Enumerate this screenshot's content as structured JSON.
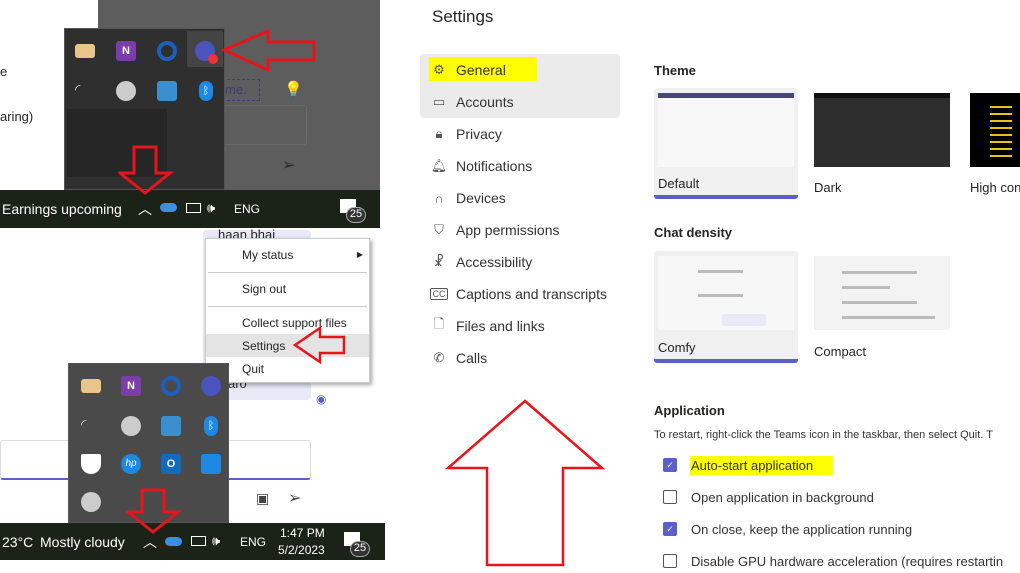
{
  "top_panel": {
    "bg_text_1": "e",
    "bg_text_2": "aring)",
    "input_text": "me.",
    "taskbar": {
      "news": "Earnings upcoming",
      "lang": "ENG",
      "notifications": "25"
    },
    "tray_icons": [
      "mail-icon",
      "onenote-icon",
      "cortana-icon",
      "teams-icon",
      "wifi-icon",
      "moon-icon",
      "network-app-icon",
      "bluetooth-icon"
    ]
  },
  "bottom_panel": {
    "bg_text": "haan bhai",
    "bg_text_2": "aro",
    "context_menu": {
      "items": [
        {
          "label": "My status",
          "submenu": true
        },
        {
          "label": "Sign out"
        },
        {
          "label": "Collect support files"
        },
        {
          "label": "Settings",
          "hovered": true
        },
        {
          "label": "Quit"
        }
      ]
    },
    "tray_icons": [
      "mail-icon",
      "onenote-icon",
      "cortana-icon",
      "teams-icon",
      "wifi-icon",
      "moon-icon",
      "network-app-icon",
      "bluetooth-icon",
      "security-warning-icon",
      "hp-icon",
      "outlook-icon",
      "cloud-sync-icon",
      "vpn-icon"
    ],
    "taskbar": {
      "weather": "23°C",
      "condition": "Mostly cloudy",
      "lang": "ENG",
      "time": "1:47 PM",
      "date": "5/2/2023",
      "notifications": "25"
    }
  },
  "settings": {
    "title": "Settings",
    "nav": [
      {
        "label": "General",
        "icon": "gear-icon",
        "selected": true,
        "highlighted": true
      },
      {
        "label": "Accounts",
        "icon": "id-card-icon"
      },
      {
        "label": "Privacy",
        "icon": "lock-icon"
      },
      {
        "label": "Notifications",
        "icon": "bell-icon"
      },
      {
        "label": "Devices",
        "icon": "headset-icon"
      },
      {
        "label": "App permissions",
        "icon": "shield-icon"
      },
      {
        "label": "Accessibility",
        "icon": "accessibility-icon"
      },
      {
        "label": "Captions and transcripts",
        "icon": "cc-icon"
      },
      {
        "label": "Files and links",
        "icon": "file-icon"
      },
      {
        "label": "Calls",
        "icon": "phone-icon"
      }
    ],
    "theme": {
      "heading": "Theme",
      "options": [
        {
          "label": "Default",
          "selected": true
        },
        {
          "label": "Dark"
        },
        {
          "label": "High con"
        }
      ]
    },
    "density": {
      "heading": "Chat density",
      "options": [
        {
          "label": "Comfy",
          "selected": true
        },
        {
          "label": "Compact"
        }
      ]
    },
    "application": {
      "heading": "Application",
      "description": "To restart, right-click the Teams icon in the taskbar, then select Quit. T",
      "options": [
        {
          "label": "Auto-start application",
          "checked": true,
          "highlighted": true
        },
        {
          "label": "Open application in background",
          "checked": false
        },
        {
          "label": "On close, keep the application running",
          "checked": true
        },
        {
          "label": "Disable GPU hardware acceleration (requires restartin",
          "checked": false
        }
      ]
    }
  },
  "colors": {
    "accent": "#5b5fc7",
    "highlight": "#ffff00",
    "arrow": "#e8141c",
    "taskbar": "#1b2218"
  }
}
